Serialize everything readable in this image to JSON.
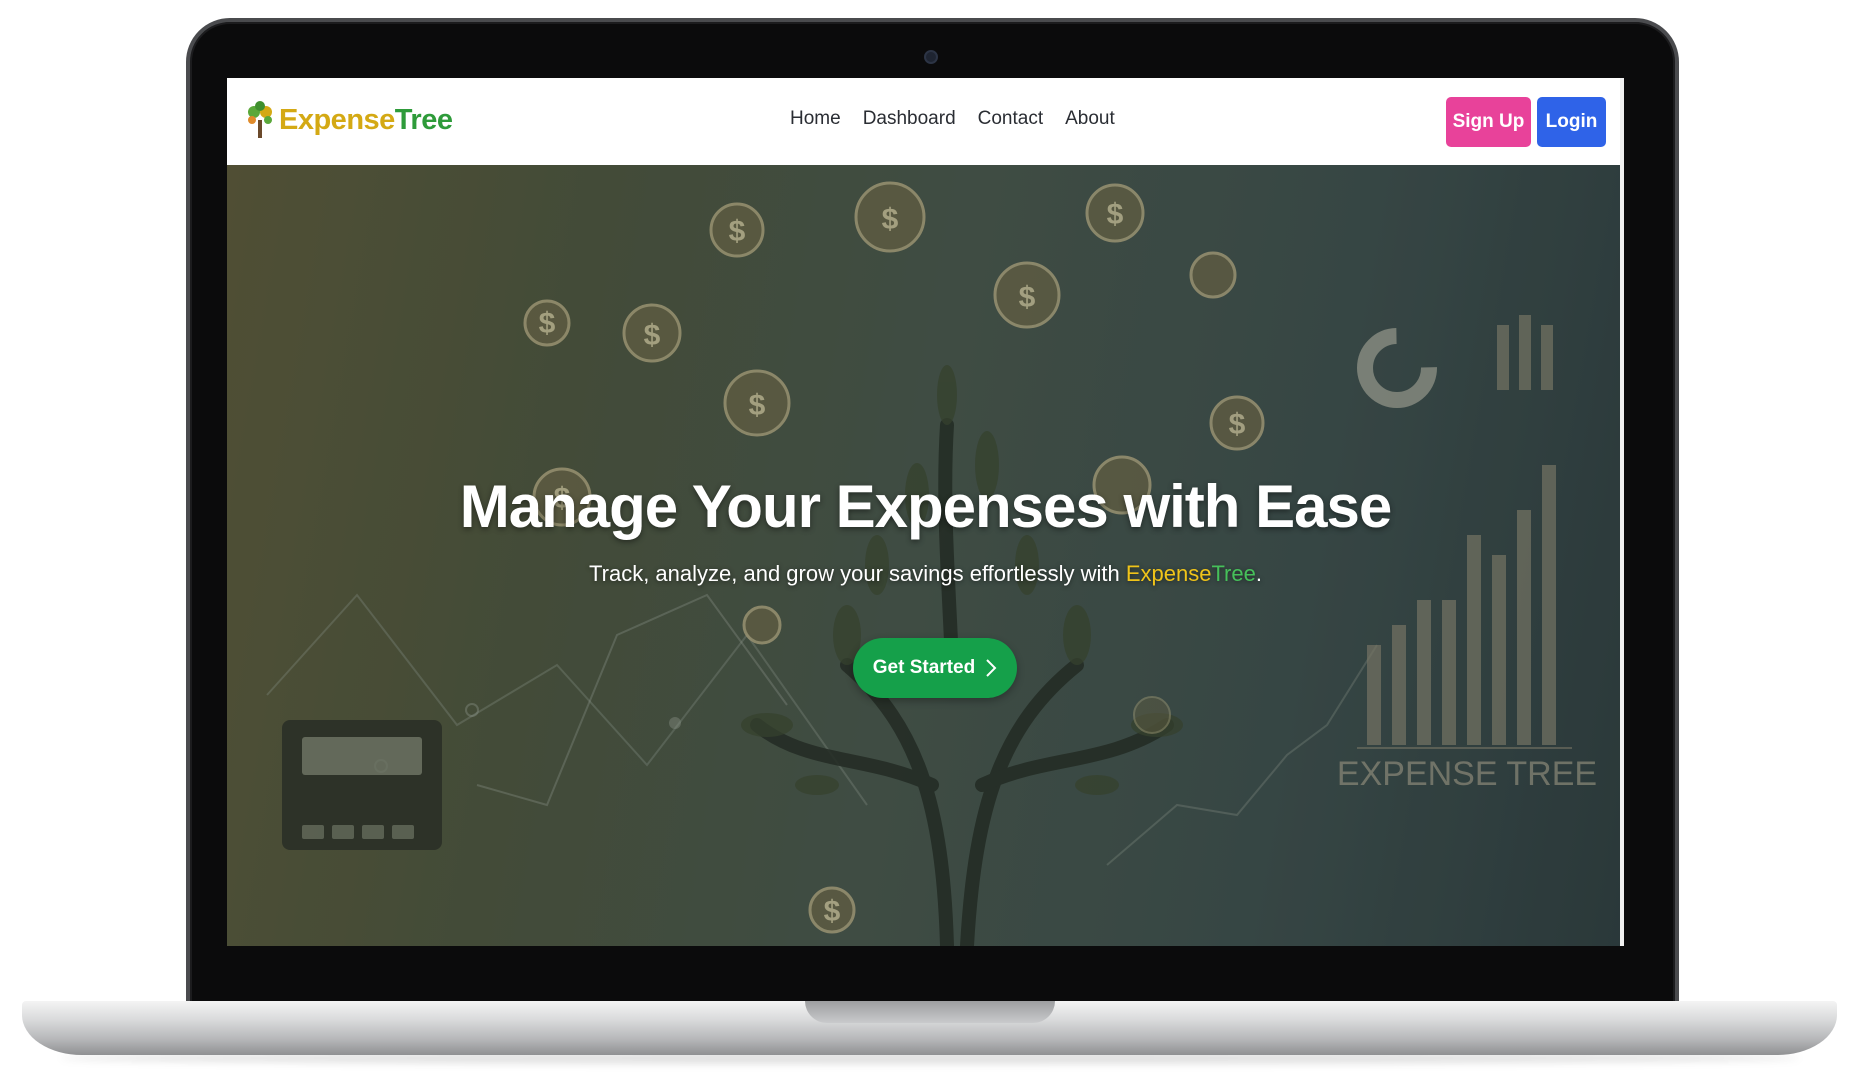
{
  "brand": {
    "expense": "Expense",
    "tree": "Tree",
    "icon": "tree-logo-icon"
  },
  "nav": {
    "links": [
      "Home",
      "Dashboard",
      "Contact",
      "About"
    ],
    "signup_label": "Sign Up",
    "login_label": "Login"
  },
  "hero": {
    "title": "Manage Your Expenses with Ease",
    "subtitle_prefix": "Track, analyze, and grow your savings effortlessly with ",
    "subtitle_expense": "Expense",
    "subtitle_tree": "Tree",
    "subtitle_suffix": ".",
    "cta_label": "Get Started",
    "cta_icon": "chevron-right-icon",
    "art_text": "EXPENSE TREE",
    "coin_symbol": "$"
  },
  "colors": {
    "brand_gold": "#d4a914",
    "brand_green": "#2e9b3a",
    "signup": "#e8429a",
    "login": "#2f63e8",
    "cta": "#15a04a"
  }
}
